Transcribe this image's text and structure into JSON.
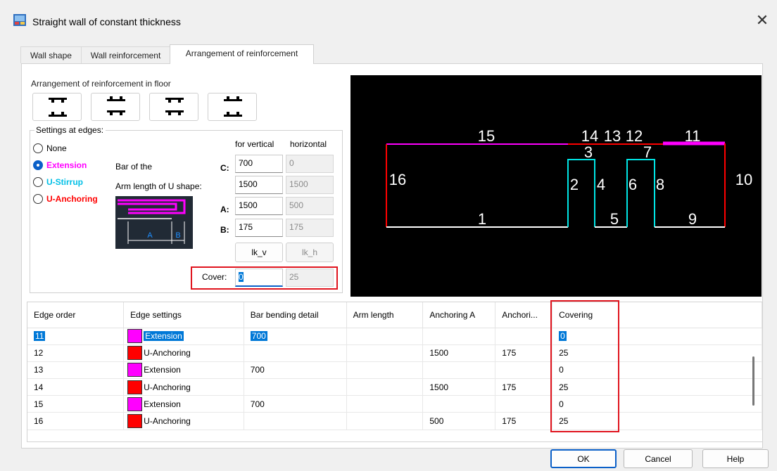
{
  "window": {
    "title": "Straight wall of constant thickness",
    "close_glyph": "✕"
  },
  "tabs": [
    {
      "label": "Wall shape",
      "active": false
    },
    {
      "label": "Wall reinforcement",
      "active": false
    },
    {
      "label": "Arrangement of reinforcement",
      "active": true
    }
  ],
  "arrangement": {
    "label": "Arrangement of reinforcement in floor",
    "buttons": [
      "arrangement-1-icon",
      "arrangement-2-icon",
      "arrangement-3-icon",
      "arrangement-4-icon"
    ]
  },
  "settings": {
    "group_label": "Settings at edges:",
    "options": [
      {
        "label": "None",
        "selected": false,
        "color": "#000000"
      },
      {
        "label": "Extension",
        "selected": true,
        "color": "#ff00ff"
      },
      {
        "label": "U-Stirrup",
        "selected": false,
        "color": "#00bfe6"
      },
      {
        "label": "U-Anchoring",
        "selected": false,
        "color": "#ff0000"
      }
    ],
    "bar_of_the": "Bar of the",
    "arm_length_label": "Arm length of U shape:",
    "col_vertical": "for vertical",
    "col_horizontal": "horizontal",
    "label_c": "C:",
    "label_a": "A:",
    "label_b": "B:",
    "c_vertical": "700",
    "c_horizontal": "0",
    "arm_vertical": "1500",
    "arm_horizontal": "1500",
    "a_vertical": "1500",
    "a_horizontal": "500",
    "b_vertical": "175",
    "b_horizontal": "175",
    "btn_lkv": "lk_v",
    "btn_lkh": "lk_h",
    "cover_label": "Cover:",
    "cover_vertical": "0",
    "cover_horizontal": "25",
    "diagram_labels": {
      "a": "A",
      "b": "B"
    }
  },
  "preview": {
    "labels": [
      {
        "text": "15",
        "color": "#ffffff"
      },
      {
        "text": "14",
        "color": "#ffffff"
      },
      {
        "text": "13",
        "color": "#ffffff"
      },
      {
        "text": "12",
        "color": "#ffffff"
      },
      {
        "text": "11",
        "color": "#ffffff"
      },
      {
        "text": "3",
        "color": "#ffffff"
      },
      {
        "text": "7",
        "color": "#ffffff"
      },
      {
        "text": "16",
        "color": "#ffffff"
      },
      {
        "text": "2",
        "color": "#ffffff"
      },
      {
        "text": "4",
        "color": "#ffffff"
      },
      {
        "text": "6",
        "color": "#ffffff"
      },
      {
        "text": "8",
        "color": "#ffffff"
      },
      {
        "text": "10",
        "color": "#ffffff"
      },
      {
        "text": "1",
        "color": "#ffffff"
      },
      {
        "text": "5",
        "color": "#ffffff"
      },
      {
        "text": "9",
        "color": "#ffffff"
      }
    ]
  },
  "table": {
    "headers": [
      "Edge order",
      "Edge settings",
      "Bar bending detail",
      "Arm length",
      "Anchoring A",
      "Anchori...",
      "Covering"
    ],
    "rows": [
      {
        "edge": "11",
        "color": "#ff00ff",
        "setting": "Extension",
        "bending": "700",
        "arm": "",
        "anch_a": "",
        "anch_b": "",
        "covering": "0",
        "selected": true
      },
      {
        "edge": "12",
        "color": "#ff0000",
        "setting": "U-Anchoring",
        "bending": "",
        "arm": "",
        "anch_a": "1500",
        "anch_b": "175",
        "covering": "25",
        "selected": false
      },
      {
        "edge": "13",
        "color": "#ff00ff",
        "setting": "Extension",
        "bending": "700",
        "arm": "",
        "anch_a": "",
        "anch_b": "",
        "covering": "0",
        "selected": false
      },
      {
        "edge": "14",
        "color": "#ff0000",
        "setting": "U-Anchoring",
        "bending": "",
        "arm": "",
        "anch_a": "1500",
        "anch_b": "175",
        "covering": "25",
        "selected": false
      },
      {
        "edge": "15",
        "color": "#ff00ff",
        "setting": "Extension",
        "bending": "700",
        "arm": "",
        "anch_a": "",
        "anch_b": "",
        "covering": "0",
        "selected": false
      },
      {
        "edge": "16",
        "color": "#ff0000",
        "setting": "U-Anchoring",
        "bending": "",
        "arm": "",
        "anch_a": "500",
        "anch_b": "175",
        "covering": "25",
        "selected": false
      }
    ]
  },
  "footer": {
    "ok": "OK",
    "cancel": "Cancel",
    "help": "Help"
  },
  "colors": {
    "highlight_box": "#e0141e",
    "selection": "#0078d7",
    "accent": "#0b60c8"
  }
}
